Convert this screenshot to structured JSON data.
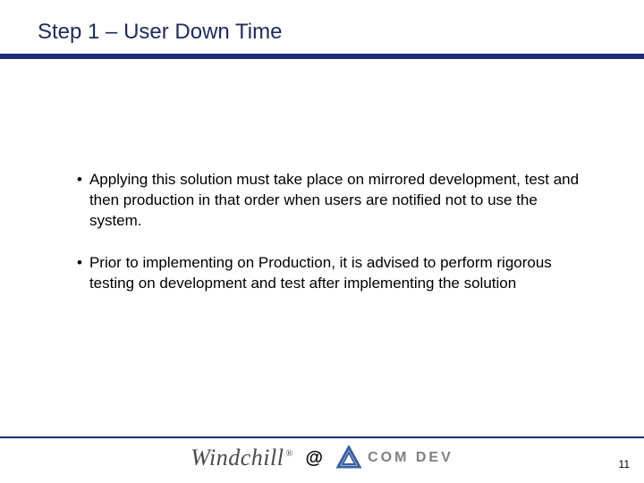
{
  "title": "Step 1 – User Down Time",
  "bullets": [
    "Applying this solution must take place on mirrored development, test and then production in that order when users are notified not to use the system.",
    "Prior to implementing on Production, it is advised to perform rigorous testing on development and test after implementing the solution"
  ],
  "footer": {
    "brand1": "Windchill",
    "reg": "®",
    "at": "@",
    "brand2": "COM DEV"
  },
  "page_number": "11",
  "colors": {
    "rule": "#1f2a7a",
    "title": "#1f2a5a"
  }
}
